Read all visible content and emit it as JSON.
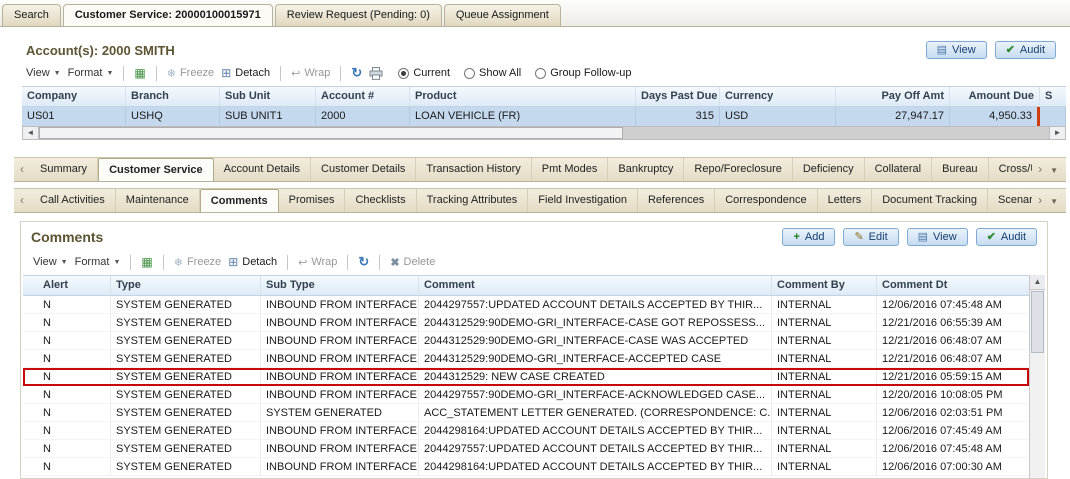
{
  "top_tabs": [
    {
      "label": "Search",
      "active": false
    },
    {
      "label": "Customer Service: 20000100015971",
      "active": true
    },
    {
      "label": "Review Request (Pending: 0)",
      "active": false
    },
    {
      "label": "Queue Assignment",
      "active": false
    }
  ],
  "account": {
    "title": "Account(s): 2000 SMITH",
    "view_button": "View",
    "audit_button": "Audit",
    "toolbar": {
      "view": "View",
      "format": "Format",
      "freeze": "Freeze",
      "detach": "Detach",
      "wrap": "Wrap",
      "filters": [
        {
          "label": "Current",
          "selected": true
        },
        {
          "label": "Show All",
          "selected": false
        },
        {
          "label": "Group Follow-up",
          "selected": false
        }
      ]
    },
    "table": {
      "columns": [
        {
          "label": "Company",
          "align": "left"
        },
        {
          "label": "Branch",
          "align": "left"
        },
        {
          "label": "Sub Unit",
          "align": "left"
        },
        {
          "label": "Account #",
          "align": "left"
        },
        {
          "label": "Product",
          "align": "left"
        },
        {
          "label": "Days Past Due",
          "align": "right"
        },
        {
          "label": "Currency",
          "align": "left"
        },
        {
          "label": "Pay Off Amt",
          "align": "right"
        },
        {
          "label": "Amount Due",
          "align": "right"
        },
        {
          "label": "S",
          "align": "left"
        }
      ],
      "row": [
        "US01",
        "USHQ",
        "SUB UNIT1",
        "2000",
        "LOAN VEHICLE (FR)",
        "315",
        "USD",
        "27,947.17",
        "4,950.33",
        ""
      ]
    }
  },
  "service_tabs": [
    {
      "label": "Summary",
      "active": false
    },
    {
      "label": "Customer Service",
      "active": true
    },
    {
      "label": "Account Details",
      "active": false
    },
    {
      "label": "Customer Details",
      "active": false
    },
    {
      "label": "Transaction History",
      "active": false
    },
    {
      "label": "Pmt Modes",
      "active": false
    },
    {
      "label": "Bankruptcy",
      "active": false
    },
    {
      "label": "Repo/Foreclosure",
      "active": false
    },
    {
      "label": "Deficiency",
      "active": false
    },
    {
      "label": "Collateral",
      "active": false
    },
    {
      "label": "Bureau",
      "active": false
    },
    {
      "label": "Cross/Up Sell Ac",
      "active": false
    }
  ],
  "sub_tabs": [
    {
      "label": "Call Activities",
      "active": false
    },
    {
      "label": "Maintenance",
      "active": false
    },
    {
      "label": "Comments",
      "active": true
    },
    {
      "label": "Promises",
      "active": false
    },
    {
      "label": "Checklists",
      "active": false
    },
    {
      "label": "Tracking Attributes",
      "active": false
    },
    {
      "label": "Field Investigation",
      "active": false
    },
    {
      "label": "References",
      "active": false
    },
    {
      "label": "Correspondence",
      "active": false
    },
    {
      "label": "Letters",
      "active": false
    },
    {
      "label": "Document Tracking",
      "active": false
    },
    {
      "label": "Scenario An",
      "active": false
    }
  ],
  "comments": {
    "title": "Comments",
    "buttons": {
      "add": "Add",
      "edit": "Edit",
      "view": "View",
      "audit": "Audit"
    },
    "toolbar": {
      "view": "View",
      "format": "Format",
      "freeze": "Freeze",
      "detach": "Detach",
      "wrap": "Wrap",
      "delete": "Delete"
    },
    "columns": [
      "Alert",
      "Type",
      "Sub Type",
      "Comment",
      "Comment By",
      "Comment Dt"
    ],
    "rows": [
      {
        "alert": "N",
        "type": "SYSTEM GENERATED",
        "sub_type": "INBOUND FROM INTERFACE",
        "comment": "2044297557:UPDATED ACCOUNT DETAILS ACCEPTED BY THIR...",
        "by": "INTERNAL",
        "dt": "12/06/2016 07:45:48 AM",
        "highlight": false
      },
      {
        "alert": "N",
        "type": "SYSTEM GENERATED",
        "sub_type": "INBOUND FROM INTERFACE",
        "comment": "2044312529:90DEMO-GRI_INTERFACE-CASE GOT REPOSSESS...",
        "by": "INTERNAL",
        "dt": "12/21/2016 06:55:39 AM",
        "highlight": false
      },
      {
        "alert": "N",
        "type": "SYSTEM GENERATED",
        "sub_type": "INBOUND FROM INTERFACE",
        "comment": "2044312529:90DEMO-GRI_INTERFACE-CASE WAS ACCEPTED",
        "by": "INTERNAL",
        "dt": "12/21/2016 06:48:07 AM",
        "highlight": false
      },
      {
        "alert": "N",
        "type": "SYSTEM GENERATED",
        "sub_type": "INBOUND FROM INTERFACE",
        "comment": "2044312529:90DEMO-GRI_INTERFACE-ACCEPTED CASE",
        "by": "INTERNAL",
        "dt": "12/21/2016 06:48:07 AM",
        "highlight": false
      },
      {
        "alert": "N",
        "type": "SYSTEM GENERATED",
        "sub_type": "INBOUND FROM INTERFACE",
        "comment": "2044312529: NEW CASE CREATED",
        "by": "INTERNAL",
        "dt": "12/21/2016 05:59:15 AM",
        "highlight": true
      },
      {
        "alert": "N",
        "type": "SYSTEM GENERATED",
        "sub_type": "INBOUND FROM INTERFACE",
        "comment": "2044297557:90DEMO-GRI_INTERFACE-ACKNOWLEDGED CASE...",
        "by": "INTERNAL",
        "dt": "12/20/2016 10:08:05 PM",
        "highlight": false
      },
      {
        "alert": "N",
        "type": "SYSTEM GENERATED",
        "sub_type": "SYSTEM GENERATED",
        "comment": "ACC_STATEMENT LETTER GENERATED. (CORRESPONDENCE: C...",
        "by": "INTERNAL",
        "dt": "12/06/2016 02:03:51 PM",
        "highlight": false
      },
      {
        "alert": "N",
        "type": "SYSTEM GENERATED",
        "sub_type": "INBOUND FROM INTERFACE",
        "comment": "2044298164:UPDATED ACCOUNT DETAILS ACCEPTED BY THIR...",
        "by": "INTERNAL",
        "dt": "12/06/2016 07:45:49 AM",
        "highlight": false
      },
      {
        "alert": "N",
        "type": "SYSTEM GENERATED",
        "sub_type": "INBOUND FROM INTERFACE",
        "comment": "2044297557:UPDATED ACCOUNT DETAILS ACCEPTED BY THIR...",
        "by": "INTERNAL",
        "dt": "12/06/2016 07:45:48 AM",
        "highlight": false
      },
      {
        "alert": "N",
        "type": "SYSTEM GENERATED",
        "sub_type": "INBOUND FROM INTERFACE",
        "comment": "2044298164:UPDATED ACCOUNT DETAILS ACCEPTED BY THIR...",
        "by": "INTERNAL",
        "dt": "12/06/2016 07:00:30 AM",
        "highlight": false
      }
    ]
  }
}
